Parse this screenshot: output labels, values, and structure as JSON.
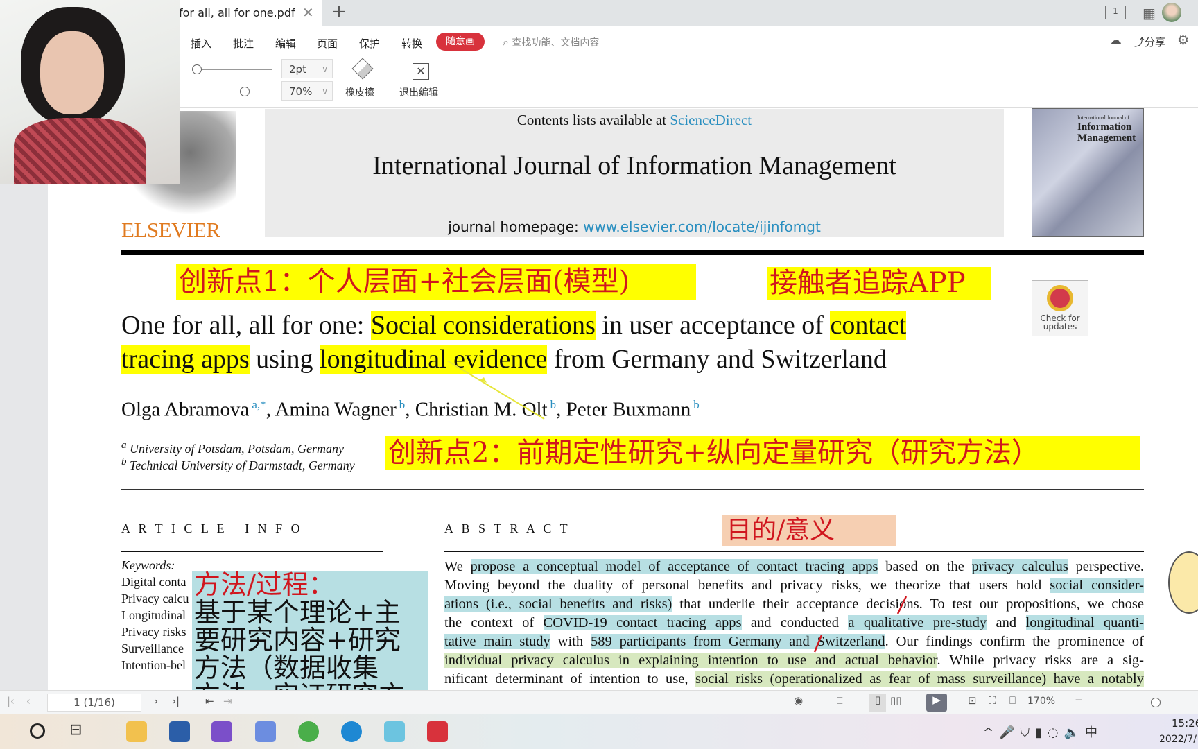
{
  "tab": {
    "title": "for all, all for one.pdf"
  },
  "menu": [
    "插入",
    "批注",
    "编辑",
    "页面",
    "保护",
    "转换"
  ],
  "menu_active": "随意画",
  "search_placeholder": "查找功能、文档内容",
  "share_label": "分享",
  "tools": {
    "stroke_width": "2pt",
    "opacity": "70%",
    "eraser": "橡皮擦",
    "exit_edit": "退出编辑",
    "stroke_width_slider": 0.05,
    "opacity_slider": 0.7
  },
  "header": {
    "contents_prefix": "Contents lists available at ",
    "contents_link": "ScienceDirect",
    "journal": "International Journal of Information Management",
    "homepage_prefix": "journal homepage: ",
    "homepage_link": "www.elsevier.com/locate/ijinfomgt",
    "publisher": "ELSEVIER",
    "cover_title_small": "International Journal of",
    "cover_title": "Information Management",
    "check_updates": "Check for updates",
    "link_color": "#2a8fc0"
  },
  "annotations": {
    "note1": "创新点1：个人层面+社会层面(模型)",
    "note2": "接触者追踪APP",
    "note3": "创新点2：前期定性研究+纵向定量研究（研究方法）",
    "note4": "目的/意义",
    "note5_title": "方法/过程：",
    "note5_lines": [
      "基于某个理论+主",
      "要研究内容+研究",
      "方法（数据收集",
      "方法、实证研究方"
    ]
  },
  "title": {
    "l1": [
      {
        "t": "One for all, all for one: ",
        "h": ""
      },
      {
        "t": "Social considerations",
        "h": "yl"
      },
      {
        "t": " in user acceptance of ",
        "h": ""
      },
      {
        "t": "contact",
        "h": "yl"
      }
    ],
    "l2": [
      {
        "t": "tracing apps",
        "h": "yl"
      },
      {
        "t": " using ",
        "h": ""
      },
      {
        "t": "longitudinal evidence",
        "h": "yl"
      },
      {
        "t": " from Germany and Switzerland",
        "h": ""
      }
    ]
  },
  "authors": [
    {
      "name": "Olga Abramova",
      "sup": "a,*"
    },
    {
      "name": "Amina Wagner",
      "sup": "b"
    },
    {
      "name": "Christian M. Olt",
      "sup": "b"
    },
    {
      "name": "Peter Buxmann",
      "sup": "b"
    }
  ],
  "affiliations": [
    {
      "sup": "a",
      "text": "University of Potsdam, Potsdam, Germany"
    },
    {
      "sup": "b",
      "text": "Technical University of Darmstadt, Germany"
    }
  ],
  "article_info": {
    "heading": "A R T I C L E   I N F O",
    "keywords_label": "Keywords:",
    "keywords": [
      "Digital conta",
      "Privacy calcu",
      "Longitudinal",
      "Privacy risks",
      "Surveillance",
      "Intention-bel"
    ]
  },
  "abstract": {
    "heading": "A B S T R A C T",
    "lines": [
      [
        {
          "t": "We ",
          "h": ""
        },
        {
          "t": "propose a conceptual model of acceptance of contact tracing apps",
          "h": "cy"
        },
        {
          "t": " based on the ",
          "h": ""
        },
        {
          "t": "privacy calculus",
          "h": "cy"
        },
        {
          "t": " perspective.",
          "h": ""
        }
      ],
      [
        {
          "t": "Moving beyond the duality of personal benefits and privacy risks, we theorize that users hold ",
          "h": ""
        },
        {
          "t": "social consider-",
          "h": "cy"
        }
      ],
      [
        {
          "t": "ations (i.e., social benefits and risks)",
          "h": "cy"
        },
        {
          "t": " that underlie their acceptance decisions. To test our propositions, we chose",
          "h": ""
        }
      ],
      [
        {
          "t": "the context of ",
          "h": ""
        },
        {
          "t": "COVID-19 contact tracing apps",
          "h": "cy"
        },
        {
          "t": " and conducted ",
          "h": ""
        },
        {
          "t": "a qualitative pre-study",
          "h": "cy"
        },
        {
          "t": " and ",
          "h": ""
        },
        {
          "t": "longitudinal quanti-",
          "h": "cy"
        }
      ],
      [
        {
          "t": "tative main study",
          "h": "cy"
        },
        {
          "t": " with ",
          "h": ""
        },
        {
          "t": "589 participants from Germany and Switzerland",
          "h": "cy"
        },
        {
          "t": ". Our findings confirm the prominence of",
          "h": ""
        }
      ],
      [
        {
          "t": "individual privacy calculus in explaining intention to use and actual behavior",
          "h": "gr"
        },
        {
          "t": ". While privacy risks are a sig-",
          "h": ""
        }
      ],
      [
        {
          "t": "nificant determinant of intention to use, ",
          "h": ""
        },
        {
          "t": "social risks (operationalized as fear of mass surveillance) have a notably",
          "h": "gr"
        }
      ]
    ]
  },
  "status": {
    "page": "1 (1/16)",
    "zoom": "170%",
    "zoom_slider": 0.7
  },
  "clock": {
    "time": "15:26",
    "date": "2022/7/"
  },
  "colors": {
    "highlight_yellow": "#ffff00",
    "highlight_cyan": "#b7dfe3",
    "highlight_green": "#d7e8bf",
    "annotation_red": "#d0161e",
    "pill_red": "#d8323c"
  }
}
